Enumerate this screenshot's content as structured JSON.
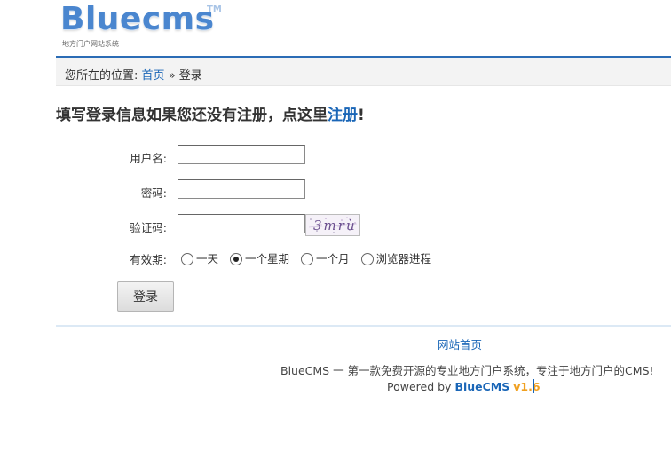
{
  "logo": {
    "wordmark": "Bluecms",
    "tm": "TM",
    "tagline": "地方门户网站系统"
  },
  "breadcrumb": {
    "prefix": "您所在的位置:",
    "home": "首页",
    "separator": "»",
    "current": "登录"
  },
  "heading": {
    "text": "填写登录信息如果您还没有注册，点这里",
    "link": "注册",
    "suffix": "!"
  },
  "form": {
    "username_label": "用户名:",
    "username_value": "",
    "password_label": "密码:",
    "password_value": "",
    "captcha_label": "验证码:",
    "captcha_value": "",
    "captcha_image_text": "3mrù",
    "validity_label": "有效期:",
    "validity_options": [
      "一天",
      "一个星期",
      "一个月",
      "浏览器进程"
    ],
    "validity_selected": "一个星期",
    "submit_label": "登录"
  },
  "footer": {
    "home_link": "网站首页",
    "description": "BlueCMS 一 第一款免费开源的专业地方门户系统，专注于地方门户的CMS!",
    "powered_by": "Powered by",
    "brand": "BlueCMS",
    "version": "v1.6"
  },
  "colors": {
    "link": "#1a66b7",
    "accent_line": "#2b6cb5",
    "version": "#f0a020"
  }
}
